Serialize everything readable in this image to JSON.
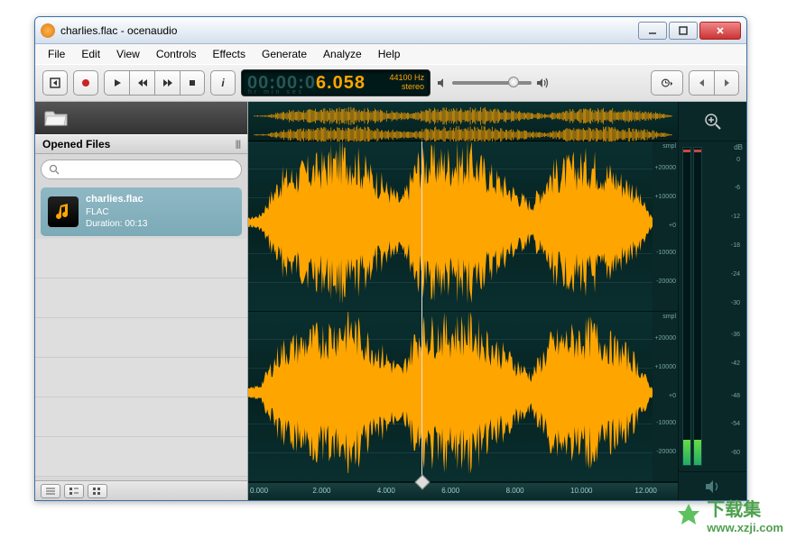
{
  "window": {
    "title": "charlies.flac - ocenaudio"
  },
  "menu": [
    "File",
    "Edit",
    "View",
    "Controls",
    "Effects",
    "Generate",
    "Analyze",
    "Help"
  ],
  "lcd": {
    "time_dim": "00:00:0",
    "time_bright": "6.058",
    "time_labels": "hr   min  sec",
    "rate": "44100 Hz",
    "channels": "stereo"
  },
  "sidebar": {
    "title": "Opened Files",
    "search_placeholder": "",
    "file": {
      "name": "charlies.flac",
      "format": "FLAC",
      "duration": "Duration: 00:13"
    }
  },
  "scale_labels": {
    "unit": "smpl",
    "pos2": "+20000",
    "pos1": "+10000",
    "zero": "+0",
    "neg1": "-10000",
    "neg2": "-20000"
  },
  "ruler": [
    "0.000",
    "2.000",
    "4.000",
    "6.000",
    "8.000",
    "10.000",
    "12.000"
  ],
  "db_scale": [
    "0",
    "-6",
    "-12",
    "-18",
    "-24",
    "-30",
    "-36",
    "-42",
    "-48",
    "-54",
    "-60"
  ],
  "db_unit": "dB",
  "watermark": {
    "cn": "下载集",
    "url": "www.xzji.com"
  },
  "chart_data": {
    "type": "waveform",
    "channels": 2,
    "sample_rate": 44100,
    "duration_sec": 13,
    "amplitude_unit": "smpl",
    "amplitude_range": [
      -30000,
      30000
    ],
    "playhead_sec": 6.058
  }
}
